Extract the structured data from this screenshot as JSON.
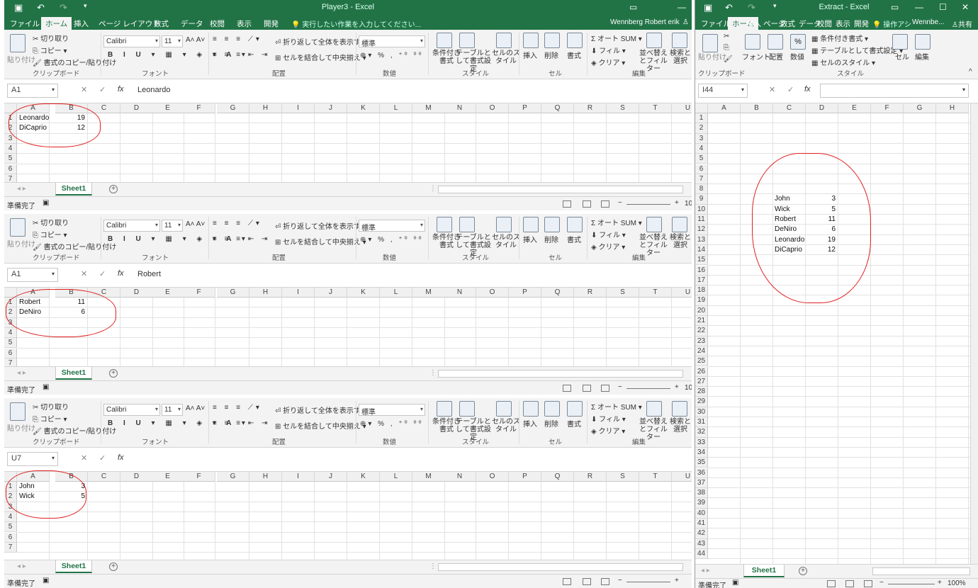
{
  "windows": {
    "player3": {
      "title": "Player3 - Excel",
      "user": "Wennberg Robert erik",
      "tell_me": "実行したい作業を入力してください...",
      "tabs": [
        "ファイル",
        "ホーム",
        "挿入",
        "ページ レイアウト",
        "数式",
        "データ",
        "校閲",
        "表示",
        "開発"
      ]
    },
    "extract": {
      "title": "Extract - Excel",
      "user": "Wennbe...",
      "share": "共有",
      "tell_me": "操作アシ",
      "tabs": [
        "ファイル",
        "ホーム",
        "挿入",
        "ページ",
        "数式",
        "データ",
        "校閲",
        "表示",
        "開発"
      ]
    }
  },
  "ribbon": {
    "clipboard": {
      "paste": "貼り付け",
      "cut": "切り取り",
      "copy": "コピー",
      "format_painter": "書式のコピー/貼り付け",
      "label": "クリップボード"
    },
    "font": {
      "name": "Calibri",
      "size": "11",
      "label": "フォント"
    },
    "alignment": {
      "wrap": "折り返して全体を表示する",
      "merge": "セルを結合して中央揃え",
      "label": "配置"
    },
    "number": {
      "format": "標準",
      "percent": "%",
      "comma": ",",
      "label": "数値"
    },
    "styles": {
      "conditional": "条件付き書式",
      "table": "テーブルとして書式設定",
      "cell": "セルのスタイル",
      "label": "スタイル"
    },
    "cells": {
      "insert": "挿入",
      "delete": "削除",
      "format": "書式",
      "label": "セル"
    },
    "editing": {
      "autosum": "オート SUM",
      "fill": "フィル",
      "clear": "クリア",
      "sort": "並べ替えとフィルター",
      "find": "検索と選択",
      "label": "編集"
    }
  },
  "extract_ribbon": {
    "cut": "",
    "paste": "貼り付け",
    "font": "フォント",
    "alignment": "配置",
    "number": "数値",
    "cond": "条件付き書式",
    "table": "テーブルとして書式設定",
    "cellstyle": "セルのスタイル",
    "cells": "セル",
    "edit": "編集",
    "clipboard": "クリップボード",
    "styles": "スタイル",
    "percent": "%"
  },
  "columns": [
    "A",
    "B",
    "C",
    "D",
    "E",
    "F",
    "G",
    "H",
    "I",
    "J",
    "K",
    "L",
    "M",
    "N",
    "O",
    "P",
    "Q",
    "R",
    "S",
    "T",
    "U"
  ],
  "extract_columns": [
    "A",
    "B",
    "C",
    "D",
    "E",
    "F",
    "G",
    "H"
  ],
  "panes": [
    {
      "namebox": "A1",
      "formula": "Leonardo",
      "rows": [
        "1",
        "2",
        "3",
        "4",
        "5",
        "6",
        "7"
      ],
      "data": [
        {
          "a": "Leonardo",
          "b": "19"
        },
        {
          "a": "DiCaprio",
          "b": "12"
        }
      ],
      "sheet": "Sheet1",
      "status": "準備完了",
      "zoom": "10"
    },
    {
      "namebox": "A1",
      "formula": "Robert",
      "rows": [
        "1",
        "2",
        "3",
        "4",
        "5",
        "6",
        "7"
      ],
      "data": [
        {
          "a": "Robert",
          "b": "11"
        },
        {
          "a": "DeNiro",
          "b": "6"
        }
      ],
      "sheet": "Sheet1",
      "status": "準備完了",
      "zoom": "10"
    },
    {
      "namebox": "U7",
      "formula": "",
      "rows": [
        "1",
        "2",
        "3",
        "4",
        "5",
        "6",
        "7"
      ],
      "data": [
        {
          "a": "John",
          "b": "3"
        },
        {
          "a": "Wick",
          "b": "5"
        }
      ],
      "sheet": "Sheet1",
      "status": "準備完了",
      "zoom": ""
    }
  ],
  "extract": {
    "namebox": "I44",
    "formula": "",
    "sheet": "Sheet1",
    "status": "準備完了",
    "zoom": "100%",
    "rows": [
      "1",
      "2",
      "3",
      "4",
      "5",
      "6",
      "7",
      "8",
      "9",
      "10",
      "11",
      "12",
      "13",
      "14",
      "15",
      "16",
      "17",
      "18",
      "19",
      "20",
      "21",
      "22",
      "23",
      "24",
      "25",
      "26",
      "27",
      "28",
      "29",
      "30",
      "31",
      "32",
      "33",
      "34",
      "35",
      "36",
      "37",
      "38",
      "39",
      "40",
      "41",
      "42",
      "43",
      "44"
    ],
    "data": [
      {
        "c": "John",
        "d": "3"
      },
      {
        "c": "Wick",
        "d": "5"
      },
      {
        "c": "Robert",
        "d": "11"
      },
      {
        "c": "DeNiro",
        "d": "6"
      },
      {
        "c": "Leonardo",
        "d": "19"
      },
      {
        "c": "DiCaprio",
        "d": "12"
      }
    ]
  },
  "colors": {
    "excel_green": "#217346",
    "annotation_red": "#e02020"
  }
}
